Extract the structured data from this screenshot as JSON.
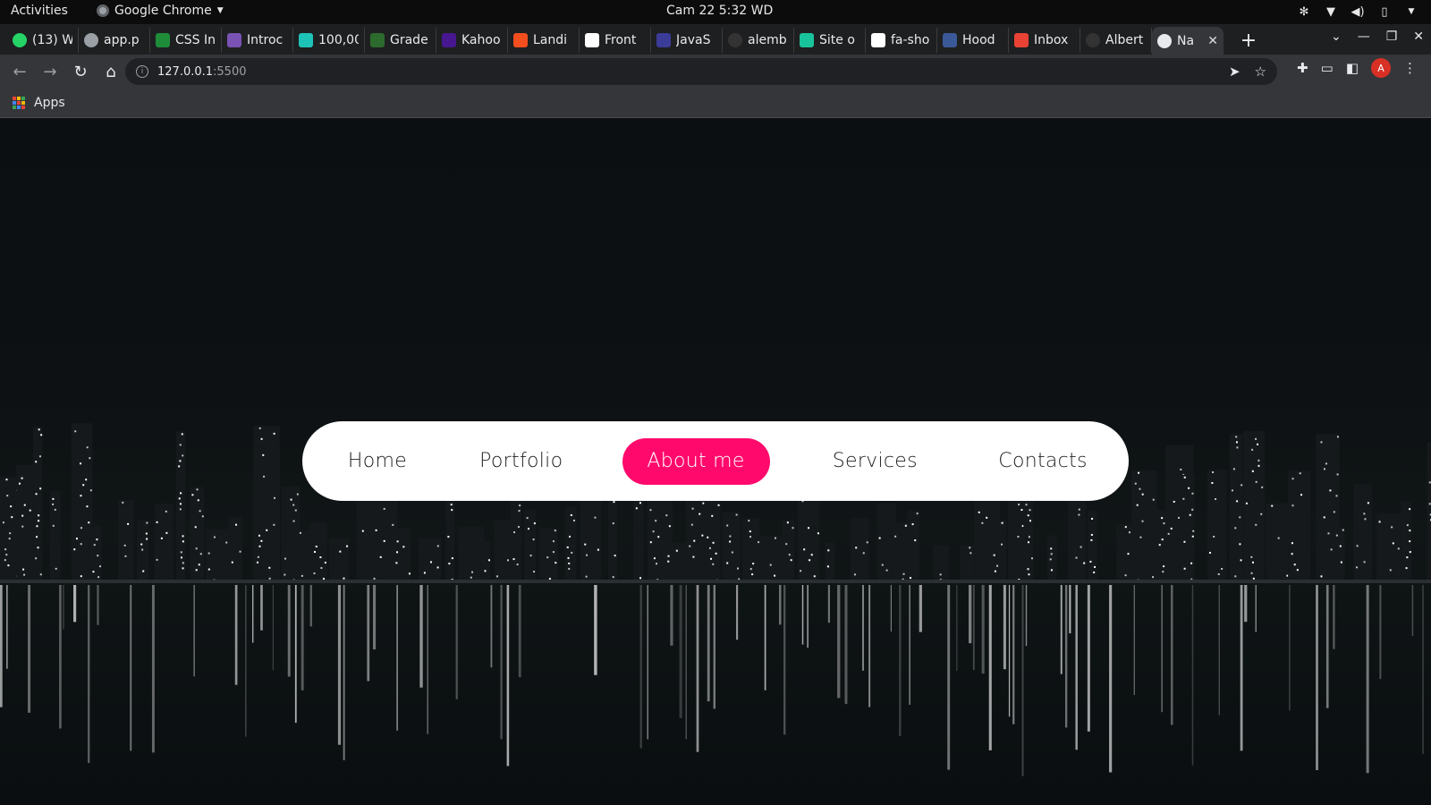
{
  "system_bar": {
    "activities": "Activities",
    "app_name": "Google Chrome",
    "clock": "Cam 22  5:32 WD"
  },
  "tabs": [
    {
      "label": "(13) W",
      "icon": "whatsapp-icon",
      "color": "#25d366"
    },
    {
      "label": "app.p",
      "icon": "globe-icon",
      "color": "#9aa0a6"
    },
    {
      "label": "CSS In",
      "icon": "w-icon",
      "color": "#1f8c3a"
    },
    {
      "label": "Introc",
      "icon": "bootstrap-icon",
      "color": "#7952b3"
    },
    {
      "label": "100,00",
      "icon": "d-icon",
      "color": "#1ec3b8"
    },
    {
      "label": "Grade",
      "icon": "palm-icon",
      "color": "#2d6a2d"
    },
    {
      "label": "Kahoo",
      "icon": "kahoot-icon",
      "color": "#46178f"
    },
    {
      "label": "Landi",
      "icon": "figma-icon",
      "color": "#f24e1e"
    },
    {
      "label": "Front",
      "icon": "frontend-icon",
      "color": "#ffffff"
    },
    {
      "label": "JavaS",
      "icon": "a-icon",
      "color": "#3b3b98"
    },
    {
      "label": "alemb",
      "icon": "github-icon",
      "color": "#333333"
    },
    {
      "label": "Site o",
      "icon": "diamond-icon",
      "color": "#19c39c"
    },
    {
      "label": "fa-sho",
      "icon": "flag-icon",
      "color": "#ffffff"
    },
    {
      "label": "Hood",
      "icon": "f-icon",
      "color": "#3b5998"
    },
    {
      "label": "Inbox",
      "icon": "gmail-icon",
      "color": "#ea4335"
    },
    {
      "label": "Albert",
      "icon": "github-icon",
      "color": "#333333"
    },
    {
      "label": "Na",
      "icon": "globe-icon",
      "color": "#e8eaed",
      "active": true
    }
  ],
  "toolbar": {
    "url_host": "127.0.0.1",
    "url_port": ":5500",
    "avatar_letter": "A"
  },
  "bookmarks": {
    "apps_label": "Apps"
  },
  "page": {
    "nav_items": [
      {
        "label": "Home",
        "active": false
      },
      {
        "label": "Portfolio",
        "active": false
      },
      {
        "label": "About me",
        "active": true
      },
      {
        "label": "Services",
        "active": false
      },
      {
        "label": "Contacts",
        "active": false
      }
    ],
    "accent_color": "#ff0a6c"
  }
}
